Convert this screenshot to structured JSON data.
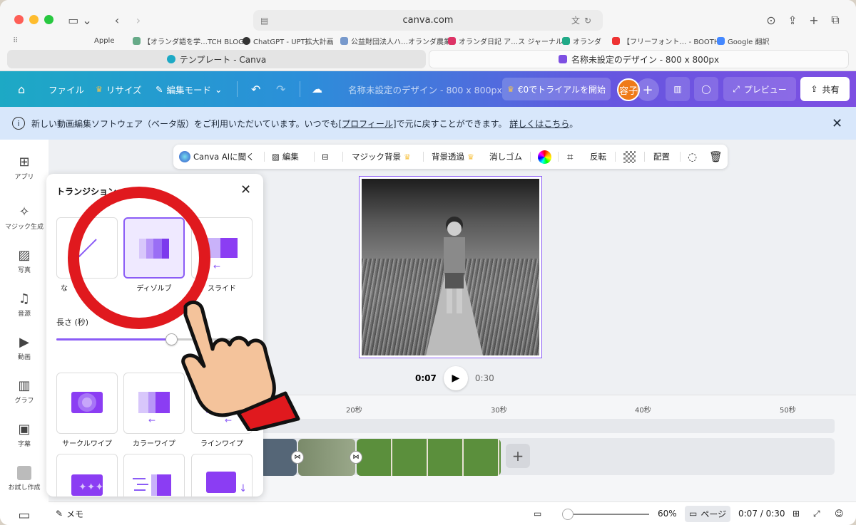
{
  "browser": {
    "url": "canva.com",
    "bookmarks": [
      "Apple",
      "【オランダ語を学…TCH BLOG",
      "ChatGPT - UPT拡大計画",
      "公益財団法人ハ…オランダ農業",
      "オランダ日記 ア…ス ジャーナル",
      "オランダ",
      "【フリーフォント… - BOOTH",
      "Google 翻訳"
    ],
    "tabs": [
      "テンプレート - Canva",
      "名称未設定のデザイン - 800 x 800px"
    ]
  },
  "header": {
    "file": "ファイル",
    "resize": "リサイズ",
    "edit_mode": "編集モード",
    "doc_title": "名称未設定のデザイン - 800 x 800px",
    "trial": "€0でトライアルを開始",
    "avatar": "容子",
    "preview": "プレビュー",
    "share": "共有"
  },
  "info": {
    "text1": "新しい動画編集ソフトウェア（ベータ版）をご利用いただいています。いつでも",
    "link1": "[プロフィール]",
    "text2": "で元に戻すことができます。",
    "link2": "詳しくはこちら",
    "text3": "。"
  },
  "sidebar": [
    "アプリ",
    "マジック生成",
    "写真",
    "音源",
    "動画",
    "グラフ",
    "字幕",
    "お試し作成"
  ],
  "context_toolbar": {
    "ai": "Canva AIに聞く",
    "edit": "編集",
    "magic_bg": "マジック背景",
    "bg_remove": "背景透過",
    "eraser": "消しゴム",
    "flip": "反転",
    "arrange": "配置"
  },
  "player": {
    "current": "0:07",
    "total": "0:30"
  },
  "timeline": {
    "ticks": [
      "20秒",
      "30秒",
      "40秒",
      "50秒"
    ]
  },
  "bottom": {
    "memo": "メモ",
    "zoom": "60%",
    "pages": "ページ",
    "time": "0:07 / 0:30"
  },
  "panel": {
    "title": "トランジション",
    "duration_label": "長さ (秒)",
    "duration_fraction": 0.62,
    "items": [
      "ディゾルブ",
      "スライド",
      "サークルワイプ",
      "カラーワイプ",
      "ラインワイプ"
    ],
    "partial_label": "な"
  },
  "colors": {
    "accent": "#8b5cf6",
    "annotation": "#e0191e"
  }
}
